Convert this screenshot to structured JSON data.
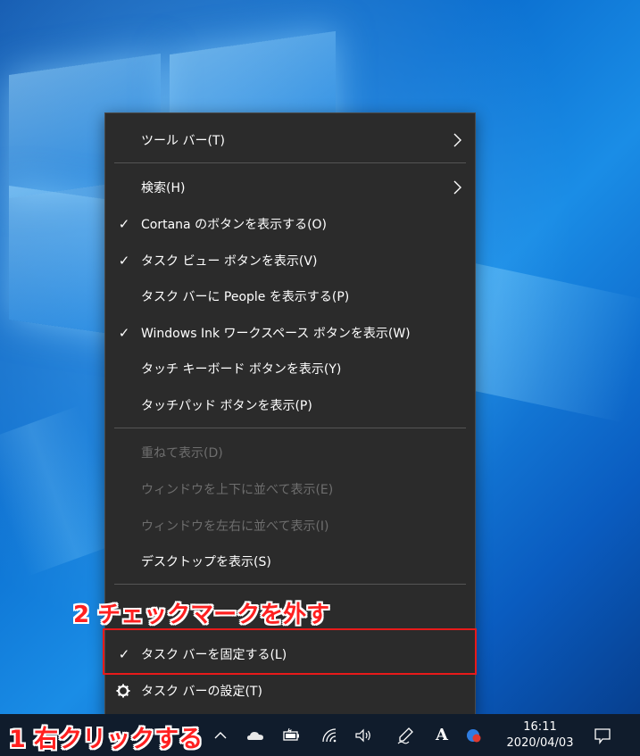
{
  "menu": {
    "items": [
      {
        "label": "ツール バー(T)",
        "checked": false,
        "disabled": false,
        "submenu": true
      },
      {
        "label": "検索(H)",
        "checked": false,
        "disabled": false,
        "submenu": true
      },
      {
        "label": "Cortana のボタンを表示する(O)",
        "checked": true,
        "disabled": false,
        "submenu": false
      },
      {
        "label": "タスク ビュー ボタンを表示(V)",
        "checked": true,
        "disabled": false,
        "submenu": false
      },
      {
        "label": "タスク バーに People を表示する(P)",
        "checked": false,
        "disabled": false,
        "submenu": false
      },
      {
        "label": "Windows Ink ワークスペース ボタンを表示(W)",
        "checked": true,
        "disabled": false,
        "submenu": false
      },
      {
        "label": "タッチ キーボード ボタンを表示(Y)",
        "checked": false,
        "disabled": false,
        "submenu": false
      },
      {
        "label": "タッチパッド ボタンを表示(P)",
        "checked": false,
        "disabled": false,
        "submenu": false
      },
      {
        "label": "重ねて表示(D)",
        "checked": false,
        "disabled": true,
        "submenu": false
      },
      {
        "label": "ウィンドウを上下に並べて表示(E)",
        "checked": false,
        "disabled": true,
        "submenu": false
      },
      {
        "label": "ウィンドウを左右に並べて表示(I)",
        "checked": false,
        "disabled": true,
        "submenu": false
      },
      {
        "label": "デスクトップを表示(S)",
        "checked": false,
        "disabled": false,
        "submenu": false
      },
      {
        "label": "タスク バーを固定する(L)",
        "checked": true,
        "disabled": false,
        "submenu": false
      },
      {
        "label": "タスク バーの設定(T)",
        "checked": false,
        "disabled": false,
        "submenu": false,
        "icon": "gear-icon"
      }
    ],
    "check_glyph": "✓"
  },
  "annotations": {
    "step1": "1 右クリックする",
    "step2": "2 チェックマークを外す"
  },
  "taskbar": {
    "tray_icons": [
      "chevron-up-icon",
      "onedrive-cloud-icon",
      "battery-icon",
      "wifi-icon",
      "volume-icon",
      "pen-workspace-icon",
      "ime-mode-icon",
      "app-tray-icon",
      "notification-icon"
    ],
    "ime_label": "A",
    "time": "16:11",
    "date": "2020/04/03"
  },
  "colors": {
    "menu_bg": "#2b2b2b",
    "annotation_red": "#e81a1a",
    "taskbar_bg": "#101c2c"
  }
}
